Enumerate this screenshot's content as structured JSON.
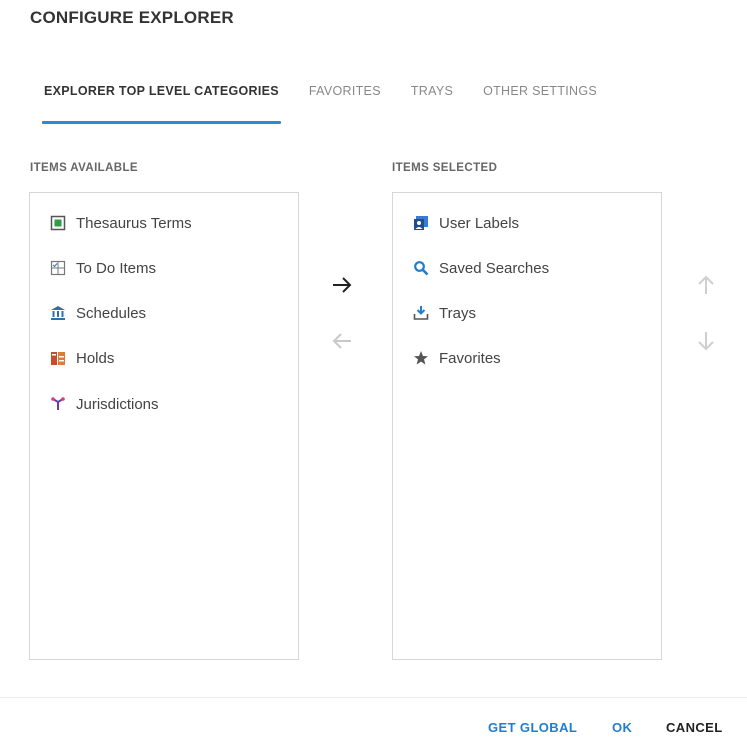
{
  "dialog": {
    "title": "CONFIGURE EXPLORER"
  },
  "tabs": [
    {
      "label": "EXPLORER TOP LEVEL CATEGORIES",
      "active": true
    },
    {
      "label": "FAVORITES",
      "active": false
    },
    {
      "label": "TRAYS",
      "active": false
    },
    {
      "label": "OTHER SETTINGS",
      "active": false
    }
  ],
  "available": {
    "label": "ITEMS AVAILABLE",
    "items": [
      {
        "label": "Thesaurus Terms",
        "icon": "thesaurus-icon"
      },
      {
        "label": "To Do Items",
        "icon": "todo-icon"
      },
      {
        "label": "Schedules",
        "icon": "bank-icon"
      },
      {
        "label": "Holds",
        "icon": "hold-icon"
      },
      {
        "label": "Jurisdictions",
        "icon": "jurisdiction-icon"
      }
    ]
  },
  "selected": {
    "label": "ITEMS SELECTED",
    "items": [
      {
        "label": "User Labels",
        "icon": "user-labels-icon"
      },
      {
        "label": "Saved Searches",
        "icon": "search-icon"
      },
      {
        "label": "Trays",
        "icon": "tray-icon"
      },
      {
        "label": "Favorites",
        "icon": "star-icon"
      }
    ]
  },
  "footer": {
    "get_global": "GET GLOBAL",
    "ok": "OK",
    "cancel": "CANCEL"
  },
  "colors": {
    "accent": "#2a8ad8",
    "button_blue": "#1f7ed0"
  }
}
